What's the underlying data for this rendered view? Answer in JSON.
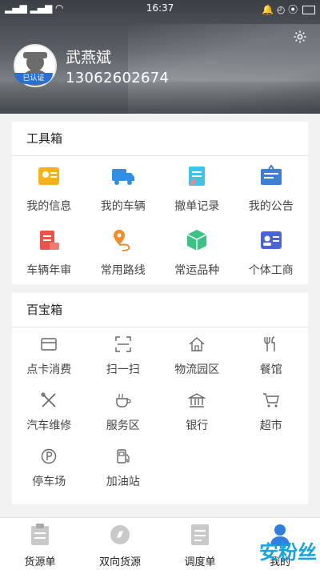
{
  "status_bar": {
    "time": "16:37"
  },
  "profile": {
    "name": "武燕斌",
    "phone": "13062602674",
    "badge": "已认证"
  },
  "toolbox": {
    "title": "工具箱",
    "items": [
      {
        "label": "我的信息",
        "icon": "id-card-icon",
        "color": "#f5b21b"
      },
      {
        "label": "我的车辆",
        "icon": "truck-icon",
        "color": "#2f8ee5"
      },
      {
        "label": "撤单记录",
        "icon": "record-icon",
        "color": "#3cc5e8"
      },
      {
        "label": "我的公告",
        "icon": "notice-board-icon",
        "color": "#3d7fd6"
      },
      {
        "label": "车辆年审",
        "icon": "inspection-icon",
        "color": "#e8534a"
      },
      {
        "label": "常用路线",
        "icon": "route-icon",
        "color": "#f28d2e"
      },
      {
        "label": "常运品种",
        "icon": "package-icon",
        "color": "#3bc285"
      },
      {
        "label": "个体工商",
        "icon": "business-license-icon",
        "color": "#4a63d6"
      }
    ]
  },
  "treasure_box": {
    "title": "百宝箱",
    "items": [
      {
        "label": "点卡消费",
        "icon": "card-icon"
      },
      {
        "label": "扫一扫",
        "icon": "scan-icon"
      },
      {
        "label": "物流园区",
        "icon": "home-icon"
      },
      {
        "label": "餐馆",
        "icon": "restaurant-icon"
      },
      {
        "label": "汽车维修",
        "icon": "repair-tools-icon"
      },
      {
        "label": "服务区",
        "icon": "coffee-icon"
      },
      {
        "label": "银行",
        "icon": "bank-icon"
      },
      {
        "label": "超市",
        "icon": "shopping-cart-icon"
      },
      {
        "label": "停车场",
        "icon": "parking-icon"
      },
      {
        "label": "加油站",
        "icon": "gas-station-icon"
      }
    ]
  },
  "tabbar": {
    "items": [
      {
        "label": "货源单",
        "icon": "clipboard-icon"
      },
      {
        "label": "双向货源",
        "icon": "compass-icon"
      },
      {
        "label": "调度单",
        "icon": "document-icon"
      },
      {
        "label": "我的",
        "icon": "user-icon",
        "active": true
      }
    ]
  },
  "watermark": "安粉丝"
}
